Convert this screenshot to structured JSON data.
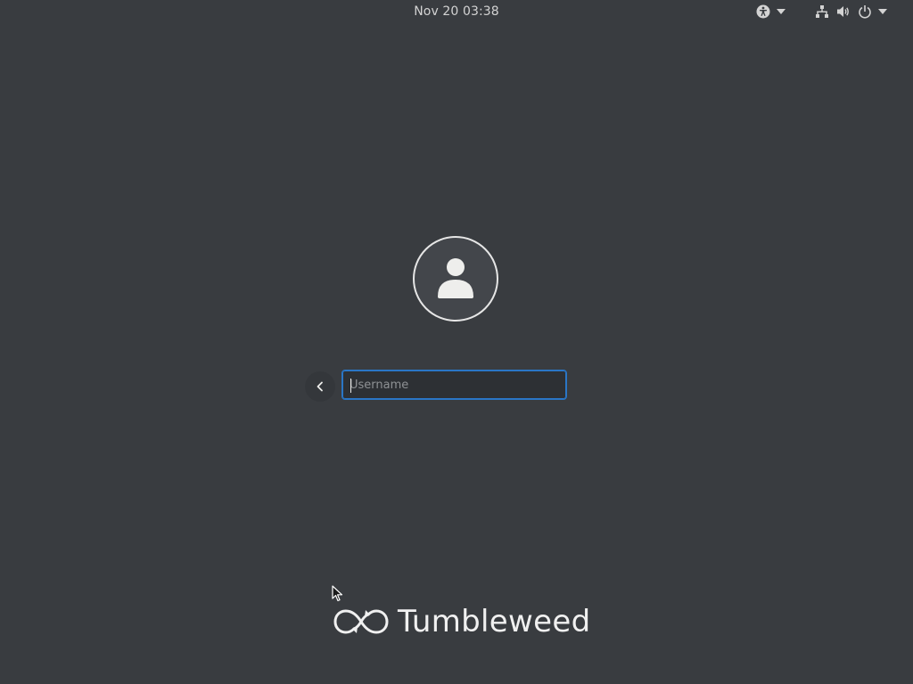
{
  "topbar": {
    "clock": "Nov 20  03:38"
  },
  "icons": {
    "accessibility": "accessibility-icon",
    "network": "network-wired-icon",
    "volume": "audio-volume-icon",
    "power": "power-icon",
    "user": "avatar-default-icon",
    "back": "go-previous-icon",
    "logo": "tumbleweed-infinity-logo"
  },
  "login": {
    "username_placeholder": "Username",
    "username_value": ""
  },
  "branding": {
    "distro_name": "Tumbleweed"
  },
  "colors": {
    "background": "#393c40",
    "focus_border": "#2a76c6",
    "text": "#eeeeec"
  }
}
